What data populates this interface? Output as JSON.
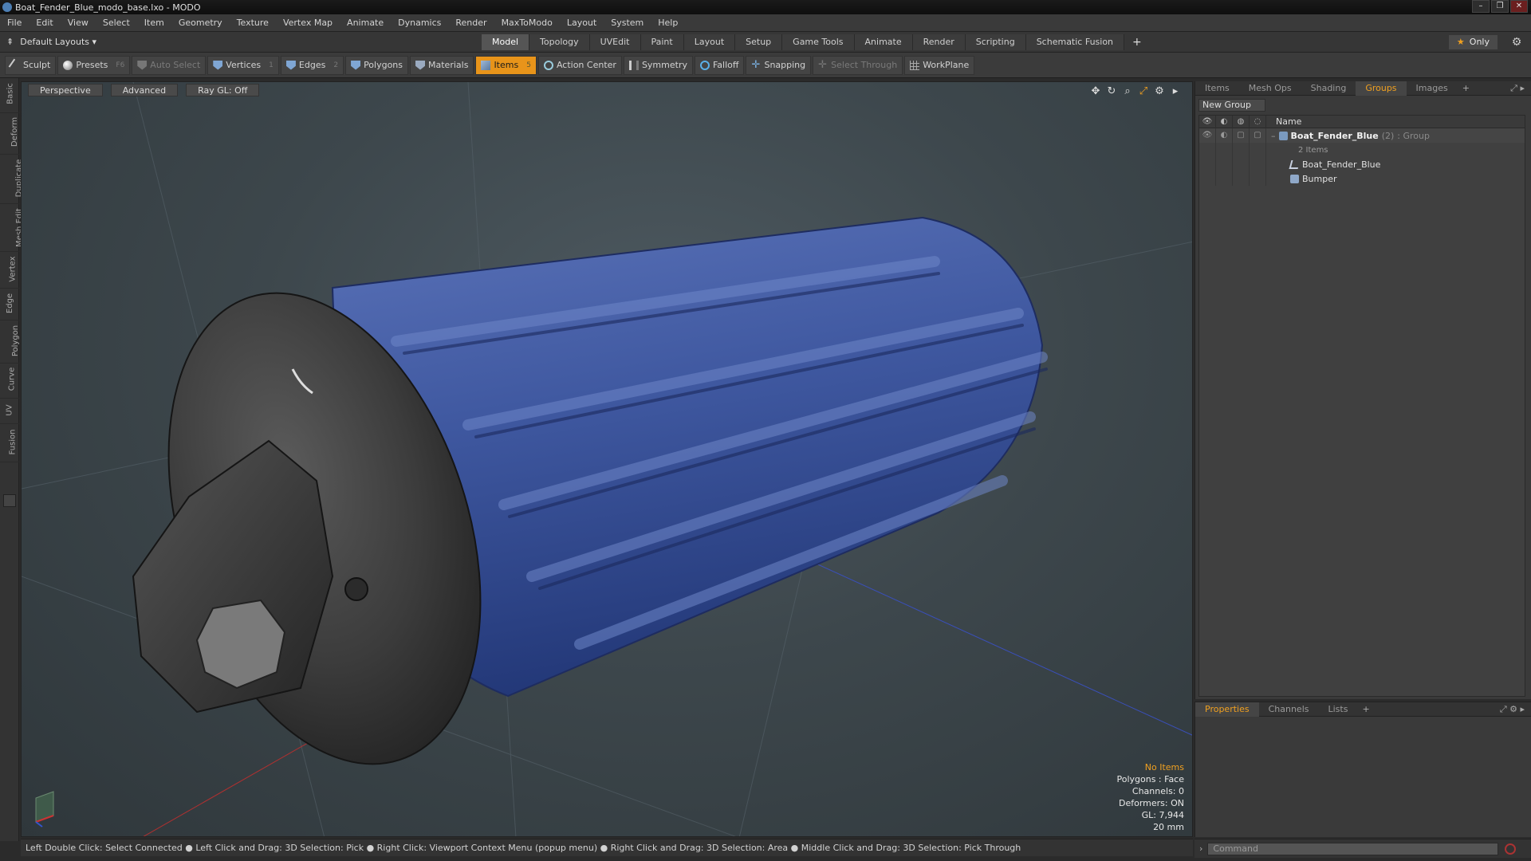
{
  "window": {
    "title": "Boat_Fender_Blue_modo_base.lxo - MODO",
    "controls": [
      "–",
      "❐",
      "✕"
    ]
  },
  "menubar": [
    "File",
    "Edit",
    "View",
    "Select",
    "Item",
    "Geometry",
    "Texture",
    "Vertex Map",
    "Animate",
    "Dynamics",
    "Render",
    "MaxToModo",
    "Layout",
    "System",
    "Help"
  ],
  "layoutbar": {
    "layout_selector": "Default Layouts ▾",
    "tabs": [
      "Model",
      "Topology",
      "UVEdit",
      "Paint",
      "Layout",
      "Setup",
      "Game Tools",
      "Animate",
      "Render",
      "Scripting",
      "Schematic Fusion"
    ],
    "active_tab": "Model",
    "only_label": "Only"
  },
  "toolbar": {
    "sculpt": "Sculpt",
    "presets": "Presets",
    "presets_key": "F6",
    "auto_select": "Auto Select",
    "vertices": "Vertices",
    "vertices_count": "1",
    "edges": "Edges",
    "edges_count": "2",
    "polygons": "Polygons",
    "materials": "Materials",
    "items": "Items",
    "items_count": "5",
    "action_center": "Action Center",
    "symmetry": "Symmetry",
    "falloff": "Falloff",
    "snapping": "Snapping",
    "select_through": "Select Through",
    "workplane": "WorkPlane"
  },
  "leftbar": [
    "Basic",
    "Deform",
    "Duplicate",
    "Mesh Edit",
    "Vertex",
    "Edge",
    "Polygon",
    "Curve",
    "UV",
    "Fusion"
  ],
  "viewport": {
    "view": "Perspective",
    "shading": "Advanced",
    "raygl": "Ray GL: Off",
    "info": {
      "selection": "No Items",
      "polygons": "Polygons : Face",
      "channels": "Channels: 0",
      "deformers": "Deformers: ON",
      "gl": "GL: 7,944",
      "scale": "20 mm"
    }
  },
  "statusbar": "Left Double Click: Select Connected ● Left Click and Drag: 3D Selection: Pick ● Right Click: Viewport Context Menu (popup menu) ● Right Click and Drag: 3D Selection: Area ● Middle Click and Drag: 3D Selection: Pick Through",
  "rightpanel": {
    "tabs": [
      "Items",
      "Mesh Ops",
      "Shading",
      "Groups",
      "Images"
    ],
    "active_tab": "Groups",
    "new_group": "New Group",
    "column_name": "Name",
    "group": {
      "name": "Boat_Fender_Blue",
      "count": "(2)",
      "type": ": Group",
      "note": "2 Items",
      "children": [
        "Boat_Fender_Blue",
        "Bumper"
      ]
    },
    "bottom_tabs": [
      "Properties",
      "Channels",
      "Lists"
    ],
    "bottom_active": "Properties"
  },
  "command": {
    "placeholder": "Command"
  }
}
